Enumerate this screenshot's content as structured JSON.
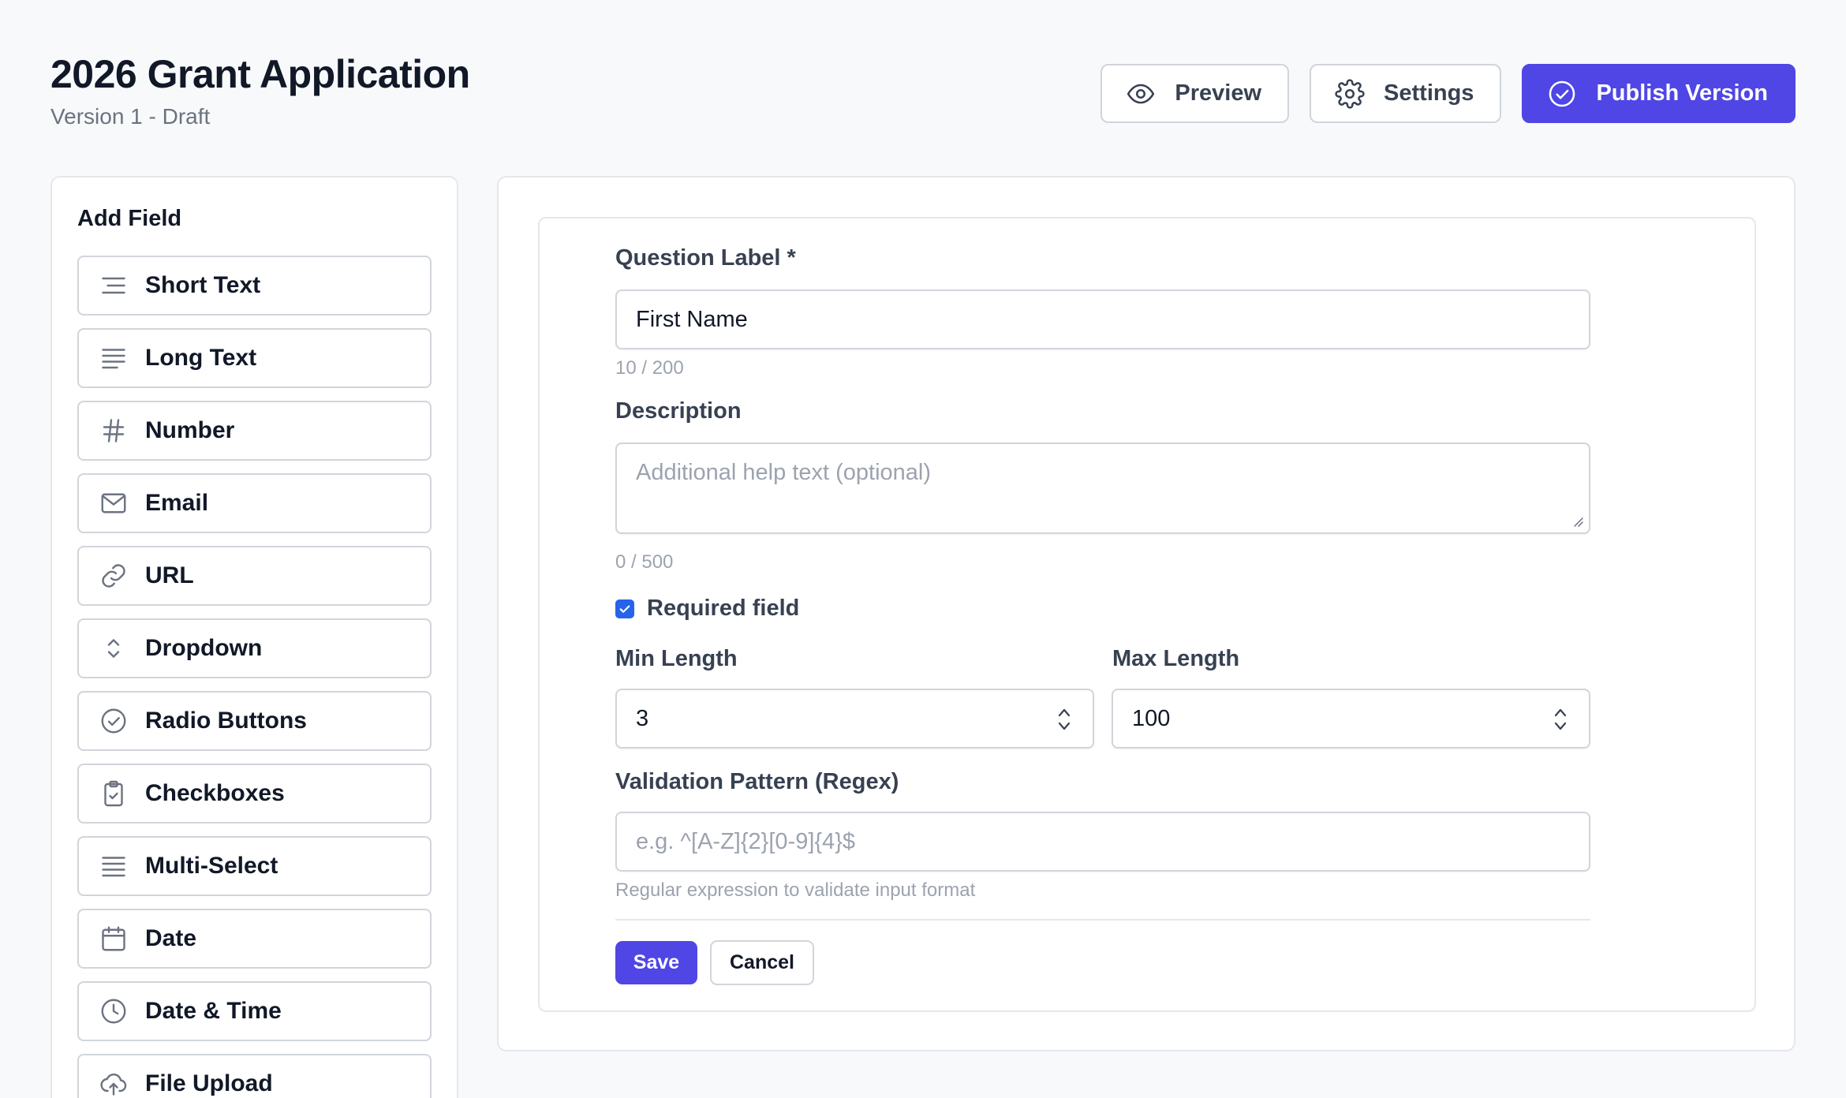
{
  "header": {
    "title": "2026 Grant Application",
    "subtitle": "Version 1 - Draft"
  },
  "actions": {
    "preview_label": "Preview",
    "settings_label": "Settings",
    "publish_label": "Publish Version"
  },
  "sidebar": {
    "title": "Add Field",
    "items": [
      {
        "label": "Short Text",
        "icon": "short-text-icon"
      },
      {
        "label": "Long Text",
        "icon": "long-text-icon"
      },
      {
        "label": "Number",
        "icon": "hash-icon"
      },
      {
        "label": "Email",
        "icon": "mail-icon"
      },
      {
        "label": "URL",
        "icon": "link-icon"
      },
      {
        "label": "Dropdown",
        "icon": "chevron-up-down-icon"
      },
      {
        "label": "Radio Buttons",
        "icon": "check-circle-icon"
      },
      {
        "label": "Checkboxes",
        "icon": "clipboard-check-icon"
      },
      {
        "label": "Multi-Select",
        "icon": "list-icon"
      },
      {
        "label": "Date",
        "icon": "calendar-icon"
      },
      {
        "label": "Date & Time",
        "icon": "clock-icon"
      },
      {
        "label": "File Upload",
        "icon": "cloud-upload-icon"
      }
    ]
  },
  "editor": {
    "question_label": "Question Label *",
    "question_value": "First Name",
    "question_counter": "10 / 200",
    "description_label": "Description",
    "description_placeholder": "Additional help text (optional)",
    "description_counter": "0 / 500",
    "required_label": "Required field",
    "required_checked": true,
    "min_length_label": "Min Length",
    "min_length_value": "3",
    "max_length_label": "Max Length",
    "max_length_value": "100",
    "regex_label": "Validation Pattern (Regex)",
    "regex_placeholder": "e.g. ^[A-Z]{2}[0-9]{4}$",
    "regex_helper": "Regular expression to validate input format",
    "save_label": "Save",
    "cancel_label": "Cancel"
  },
  "colors": {
    "primary": "#4f46e5",
    "checkbox": "#2563eb",
    "border": "#d1d5db",
    "background": "#f8f9fa"
  }
}
